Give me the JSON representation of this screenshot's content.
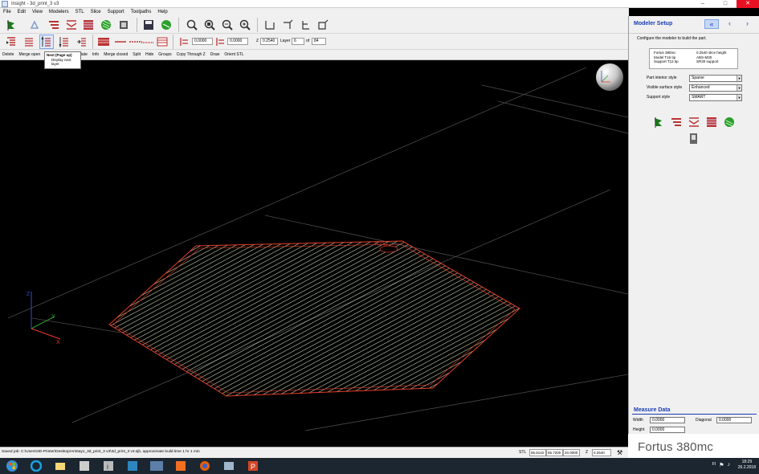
{
  "window": {
    "title": "Insight - 3d_print_3 v3"
  },
  "menu": [
    "File",
    "Edit",
    "View",
    "Modelers",
    "STL",
    "Slice",
    "Support",
    "Toolpaths",
    "Help"
  ],
  "layer_toolbar": {
    "field1": "0.0000",
    "field2": "0.0000",
    "z_label": "Z",
    "z_value": "0.2540",
    "layer_label": "Layer",
    "layer_value": "6",
    "of_label": "of",
    "of_value": "84"
  },
  "edit_toolbar": [
    "Delete",
    "Merge open",
    "Rotate",
    "Info",
    "Merge closed",
    "Split",
    "Hide",
    "Groups",
    "Copy Through Z",
    "Draw",
    "Orient STL"
  ],
  "tooltip": {
    "title": "Next (Page up)",
    "line1": "Display next",
    "line2": "layer"
  },
  "panel": {
    "title": "Modeler Setup",
    "description": "Configure the modeler to build the part.",
    "info": {
      "r1c1": "Fortus 380mc",
      "r1c2": "0.2540 slice height",
      "r2c1": "Model    T16 tip",
      "r2c2": "ABS-M30",
      "r3c1": "Support   T12 tip",
      "r3c2": "SR30 support"
    },
    "styles": [
      {
        "label": "Part interior style",
        "value": "Sparse"
      },
      {
        "label": "Visible surface style",
        "value": "Enhanced"
      },
      {
        "label": "Support style",
        "value": "SMART"
      }
    ],
    "measure": {
      "title": "Measure Data",
      "width_label": "Width",
      "width_value": "0.0000",
      "height_label": "Height",
      "height_value": "0.0000",
      "diagonal_label": "Diagonal",
      "diagonal_value": "0.0000"
    },
    "brand": "Fortus 380mc"
  },
  "status": {
    "text": "Saved job:  C:\\Users\\3D-Printer\\Desktop\\Aristayo_3d_print_3 v3\\3d_print_3 v3.sjb,  approximate build time 1 hr 1 min",
    "stl_label": "STL",
    "f1": "55.8142",
    "f2": "55.7200",
    "f3": "20.0000",
    "z_label": "Z",
    "z_value": "0.2540"
  },
  "taskbar": {
    "time": "18:29",
    "date": "26.2.2018",
    "lang": "FI"
  },
  "colors": {
    "accent": "#1a3cb3",
    "part_outline": "#e83b2a",
    "part_fill": "#c7d9a8"
  }
}
